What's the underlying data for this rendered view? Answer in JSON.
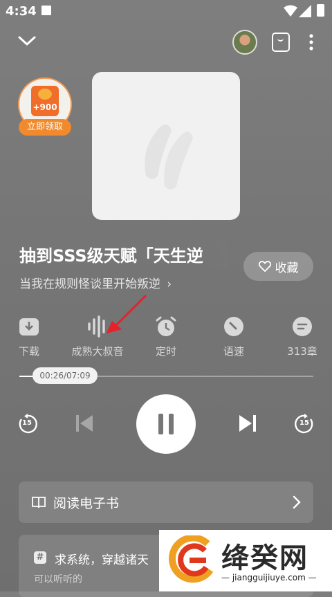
{
  "status_bar": {
    "time": "4:34"
  },
  "reward": {
    "amount": "+900",
    "claim_label": "立即领取"
  },
  "book": {
    "title": "抽到SSS级天赋「天生逆",
    "subtitle": "当我在规则怪谈里开始叛逆",
    "favorite_label": "收藏"
  },
  "tools": [
    {
      "icon": "download-icon",
      "label": "下载"
    },
    {
      "icon": "voice-wave-icon",
      "label": "成熟大叔音"
    },
    {
      "icon": "alarm-clock-icon",
      "label": "定时"
    },
    {
      "icon": "speed-gauge-icon",
      "label": "语速"
    },
    {
      "icon": "chapters-icon",
      "label": "313章"
    }
  ],
  "player": {
    "time_display": "00:26/07:09",
    "progress_fraction": 0.06,
    "rewind_label": "15",
    "forward_label": "15"
  },
  "read_ebook_label": "阅读电子书",
  "recommend": {
    "hash": "#",
    "title": "求系统，穿越诸天",
    "subtitle": "可以听听的"
  },
  "watermark": {
    "name": "绛癸网",
    "url": "jiangguijiuye.com"
  },
  "colors": {
    "accent_orange": "#f08a2c",
    "background": "#777777"
  }
}
